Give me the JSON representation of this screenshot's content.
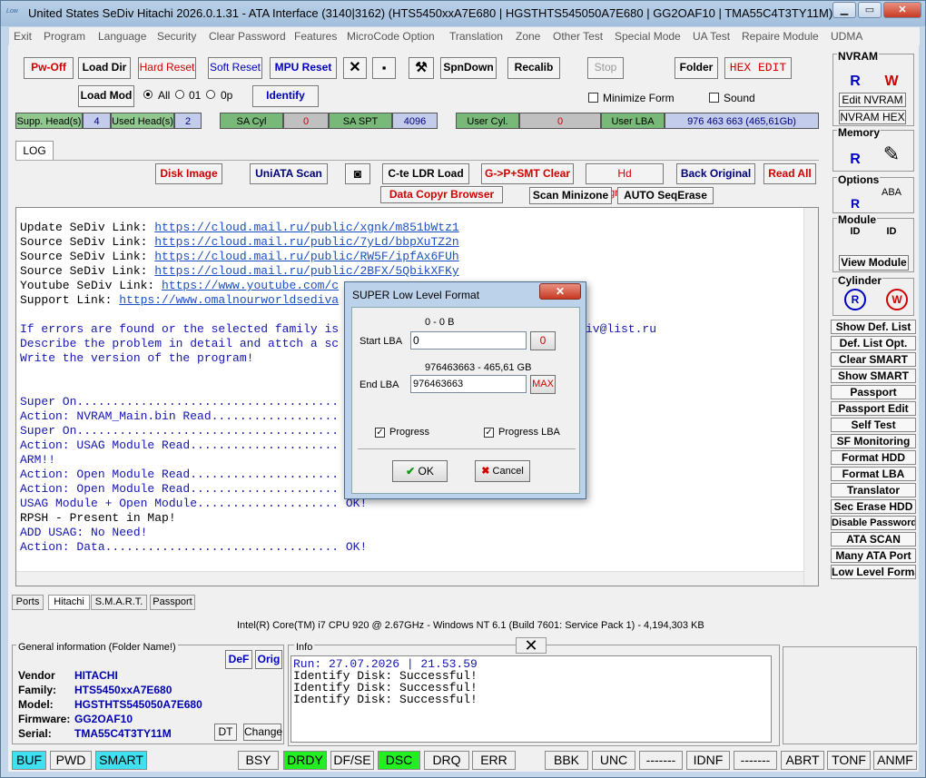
{
  "window": {
    "title": "United States  SeDiv Hitachi  2026.0.1.31 - ATA Interface  (3140|3162) (HTS5450xxA7E680 | HGSTHTS545050A7E680 | GG2OAF10 | TMA55C4T3TY11M)",
    "icon_text": "Low"
  },
  "menu": [
    "Exit",
    "Program",
    "Language",
    "Security",
    "Clear Password",
    "Features",
    "MicroCode Option",
    "Translation",
    "Zone",
    "Other Test",
    "Special Mode",
    "UA Test",
    "Repaire Module",
    "UDMA"
  ],
  "toolbar": {
    "pw_off": "Pw-Off",
    "load_dir": "Load Dir",
    "hard_reset": "Hard Reset",
    "soft_reset": "Soft Reset",
    "mpu_reset": "MPU Reset",
    "spndown": "SpnDown",
    "recalib": "Recalib",
    "stop": "Stop",
    "folder": "Folder",
    "hex_edit": "HEX EDIT",
    "load_mod": "Load Mod",
    "radio_all": "All",
    "radio_01": "01",
    "radio_0p": "0p",
    "identify": "Identify",
    "minimize_form": "Minimize Form",
    "sound": "Sound"
  },
  "status": {
    "supp_heads_label": "Supp. Head(s)",
    "supp_heads": "4",
    "used_heads_label": "Used Head(s)",
    "used_heads": "2",
    "sa_cyl_label": "SA Cyl",
    "sa_cyl": "0",
    "sa_spt_label": "SA SPT",
    "sa_spt": "4096",
    "user_cyl_label": "User Cyl.",
    "user_cyl": "0",
    "user_lba_label": "User LBA",
    "user_lba": "976 463 663  (465,61Gb)"
  },
  "log_tab": "LOG",
  "actions": {
    "disk_image": "Disk Image",
    "uniata_scan": "UniATA Scan",
    "cte_ldr": "C-te LDR Load",
    "gp_smt": "G->P+SMT Clear",
    "hd_degradation": "Hd Degradation",
    "back_original": "Back Original",
    "read_all": "Read All",
    "data_copyr": "Data Copyr Browser",
    "scan_minizone": "Scan Minizone",
    "auto_seqerase": "AUTO SeqErase"
  },
  "log": {
    "links": [
      {
        "label": "Update SeDiv Link: ",
        "url": "https://cloud.mail.ru/public/xgnk/m851bWtz1"
      },
      {
        "label": "Source SeDiv Link: ",
        "url": "https://cloud.mail.ru/public/7yLd/bbpXuTZ2n"
      },
      {
        "label": "Source SeDiv Link: ",
        "url": "https://cloud.mail.ru/public/RW5F/ipfAx6FUh"
      },
      {
        "label": "Source SeDiv Link: ",
        "url": "https://cloud.mail.ru/public/2BFX/5QbikXFKy"
      },
      {
        "label": "Youtube SeDiv Link: ",
        "url": "https://www.youtube.com/c"
      },
      {
        "label": "Support Link: ",
        "url": "https://www.omalnourworldsediva"
      }
    ],
    "msg1": "If errors are found or the selected family is",
    "msg1_tail": "iv@list.ru",
    "msg2": "Describe the problem in detail and attch a sc",
    "msg3": "Write the version of the program!",
    "lines": [
      {
        "t": "Super On.....................................",
        "c": "blue"
      },
      {
        "t": "Action: NVRAM_Main.bin Read..................",
        "c": "blue"
      },
      {
        "t": "Super On.....................................",
        "c": "blue"
      },
      {
        "t": "Action: USAG Module Read.....................",
        "c": "blue"
      },
      {
        "t": "ARM!!",
        "c": "blue"
      },
      {
        "t": "Action: Open Module Read.....................",
        "c": "blue"
      },
      {
        "t": "Action: Open Module Read.....................",
        "c": "blue"
      },
      {
        "t": "USAG Module + Open Module.................... OK!",
        "c": "blue"
      },
      {
        "t": "RPSH - Present in Map!",
        "c": "black"
      },
      {
        "t": "ADD USAG: No Need!",
        "c": "blue"
      },
      {
        "t": "Action: Data................................. OK!",
        "c": "blue"
      }
    ]
  },
  "bottom_tabs": [
    "Ports",
    "Hitachi",
    "S.M.A.R.T.",
    "Passport"
  ],
  "sysinfo": "Intel(R) Core(TM) i7 CPU 920  @ 2.67GHz - Windows NT 6.1 (Build 7601: Service Pack 1) -  4,194,303 KB",
  "general": {
    "title": "General information (Folder Name!)",
    "def": "DeF",
    "orig": "Orig",
    "dt": "DT",
    "change": "Change",
    "vendor_label": "Vendor",
    "vendor": "HITACHI",
    "family_label": "Family:",
    "family": "HTS5450xxA7E680",
    "model_label": "Model:",
    "model": "HGSTHTS545050A7E680",
    "firmware_label": "Firmware:",
    "firmware": "GG2OAF10",
    "serial_label": "Serial:",
    "serial": "TMA55C4T3TY11M"
  },
  "info": {
    "title": "Info",
    "lines": [
      "Run: 27.07.2026 | 21.53.59",
      "Identify Disk: Successful!",
      "Identify Disk: Successful!",
      "Identify Disk: Successful!"
    ]
  },
  "leds": [
    "BUF",
    "PWD",
    "SMART",
    "BSY",
    "DRDY",
    "DF/SE",
    "DSC",
    "DRQ",
    "ERR",
    "BBK",
    "UNC",
    "-------",
    "IDNF",
    "-------",
    "ABRT",
    "TONF",
    "ANMF"
  ],
  "side": {
    "nvram": "NVRAM",
    "edit_nvram": "Edit NVRAM",
    "nvram_hex": "NVRAM HEX",
    "memory": "Memory",
    "options": "Options",
    "module": "Module",
    "view_module": "View Module",
    "cylinder": "Cylinder",
    "r": "R",
    "w": "W",
    "id": "ID",
    "aba": "ABA",
    "buttons": [
      {
        "t": "Show Def. List",
        "c": "black"
      },
      {
        "t": "Def. List Opt.",
        "c": "red"
      },
      {
        "t": "Clear SMART",
        "c": "red"
      },
      {
        "t": "Show SMART",
        "c": "black"
      },
      {
        "t": "Passport",
        "c": "black"
      },
      {
        "t": "Passport Edit",
        "c": "blue"
      },
      {
        "t": "Self Test",
        "c": "blue"
      },
      {
        "t": "SF Monitoring",
        "c": "blue"
      },
      {
        "t": "Format HDD",
        "c": "black"
      },
      {
        "t": "Format LBA",
        "c": "black"
      },
      {
        "t": "Translator",
        "c": "black"
      },
      {
        "t": "Sec Erase HDD",
        "c": "red"
      },
      {
        "t": "Disable Password",
        "c": "black"
      },
      {
        "t": "ATA SCAN",
        "c": "black"
      },
      {
        "t": "Many ATA Port",
        "c": "black"
      },
      {
        "t": "Low Level Format",
        "c": "black"
      }
    ]
  },
  "dialog": {
    "title": "SUPER Low Level Format",
    "start_size": "0 - 0 B",
    "start_label": "Start LBA",
    "start_value": "0",
    "start_btn": "0",
    "end_size": "976463663 - 465,61 GB",
    "end_label": "End LBA",
    "end_value": "976463663",
    "max_btn": "MAX",
    "progress": "Progress",
    "progress_lba": "Progress LBA",
    "ok": "OK",
    "cancel": "Cancel"
  }
}
